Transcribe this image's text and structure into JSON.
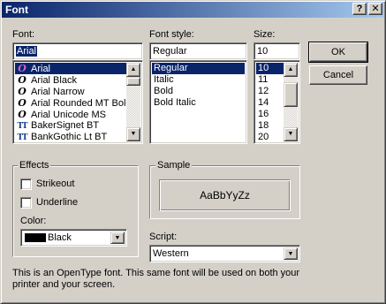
{
  "window": {
    "title": "Font",
    "help_button": "?",
    "close_button": "X"
  },
  "font": {
    "label": "Font:",
    "value": "Arial",
    "items": [
      {
        "name": "Arial",
        "icon": "opentype-icon",
        "glyph": "O"
      },
      {
        "name": "Arial Black",
        "icon": "opentype-icon",
        "glyph": "O"
      },
      {
        "name": "Arial Narrow",
        "icon": "opentype-icon",
        "glyph": "O"
      },
      {
        "name": "Arial Rounded MT Bold",
        "icon": "opentype-icon",
        "glyph": "O"
      },
      {
        "name": "Arial Unicode MS",
        "icon": "opentype-icon",
        "glyph": "O"
      },
      {
        "name": "BakerSignet BT",
        "icon": "truetype-icon",
        "glyph": "TT"
      },
      {
        "name": "BankGothic Lt BT",
        "icon": "truetype-icon",
        "glyph": "TT"
      }
    ],
    "selected_index": 0
  },
  "font_style": {
    "label": "Font style:",
    "value": "Regular",
    "items": [
      "Regular",
      "Italic",
      "Bold",
      "Bold Italic"
    ],
    "selected_index": 0
  },
  "size": {
    "label": "Size:",
    "value": "10",
    "items": [
      "10",
      "11",
      "12",
      "14",
      "16",
      "18",
      "20"
    ],
    "selected_index": 0
  },
  "buttons": {
    "ok": "OK",
    "cancel": "Cancel"
  },
  "effects": {
    "title": "Effects",
    "strikeout": "Strikeout",
    "underline": "Underline",
    "strikeout_checked": false,
    "underline_checked": false,
    "color_label": "Color:",
    "color_value": "Black",
    "color_swatch": "#000000"
  },
  "sample": {
    "title": "Sample",
    "text": "AaBbYyZz"
  },
  "script": {
    "label": "Script:",
    "value": "Western"
  },
  "description": "This is an OpenType font. This same font will be used on both your printer and your screen.",
  "colors": {
    "selection": "#0a246a",
    "dialog_bg": "#d4d0c8"
  }
}
